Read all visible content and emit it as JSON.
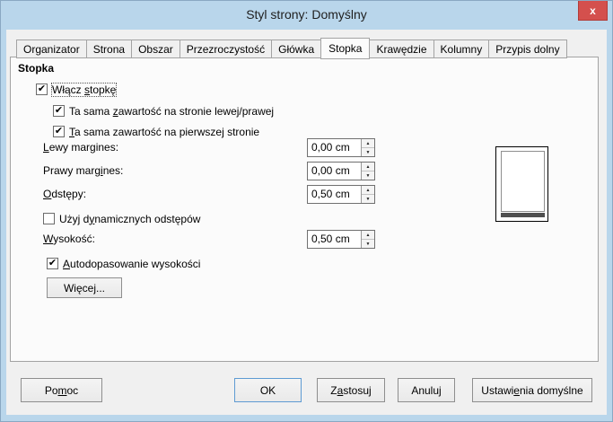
{
  "window": {
    "title": "Styl strony: Domyślny"
  },
  "icons": {
    "close": "x",
    "check": "✔",
    "spin_up": "▲",
    "spin_down": "▼"
  },
  "colors": {
    "titlebar": "#b9d6eb",
    "close_button": "#d4504d",
    "ok_focus_border": "#5e9bd3",
    "dialog_bg": "#f0f0f0"
  },
  "tabs": {
    "active_index": 5,
    "items": [
      {
        "label": "Organizator"
      },
      {
        "label": "Strona"
      },
      {
        "label": "Obszar"
      },
      {
        "label": "Przezroczystość"
      },
      {
        "label": "Główka"
      },
      {
        "label": "Stopka"
      },
      {
        "label": "Krawędzie"
      },
      {
        "label": "Kolumny"
      },
      {
        "label": "Przypis dolny"
      }
    ]
  },
  "panel": {
    "heading": "Stopka"
  },
  "fields": {
    "enable_footer": {
      "pre": "Włącz ",
      "key": "s",
      "post": "topkę",
      "checked": true
    },
    "same_lr": {
      "pre": "Ta sama ",
      "key": "z",
      "post": "awartość na stronie lewej/prawej",
      "checked": true
    },
    "same_first": {
      "pre": "",
      "key": "T",
      "post": "a sama zawartość na pierwszej stronie",
      "checked": true
    },
    "left_margin": {
      "pre": "",
      "key": "L",
      "post": "ewy margines:",
      "value": "0,00 cm"
    },
    "right_margin": {
      "pre": "Prawy marg",
      "key": "i",
      "post": "nes:",
      "value": "0,00 cm"
    },
    "spacing": {
      "pre": "",
      "key": "O",
      "post": "dstępy:",
      "value": "0,50 cm"
    },
    "dynamic_spacing": {
      "pre": "Użyj d",
      "key": "y",
      "post": "namicznych odstępów",
      "checked": false
    },
    "height": {
      "pre": "",
      "key": "W",
      "post": "ysokość:",
      "value": "0,50 cm"
    },
    "autofit": {
      "pre": "",
      "key": "A",
      "post": "utodopasowanie wysokości",
      "checked": true
    }
  },
  "buttons": {
    "more": {
      "pre": "Więce",
      "key": "j",
      "post": "..."
    },
    "help": {
      "pre": "Po",
      "key": "m",
      "post": "oc"
    },
    "ok": {
      "label": "OK"
    },
    "apply": {
      "pre": "Z",
      "key": "a",
      "post": "stosuj"
    },
    "cancel": {
      "label": "Anuluj"
    },
    "reset": {
      "pre": "Ustawi",
      "key": "e",
      "post": "nia domyślne"
    }
  }
}
